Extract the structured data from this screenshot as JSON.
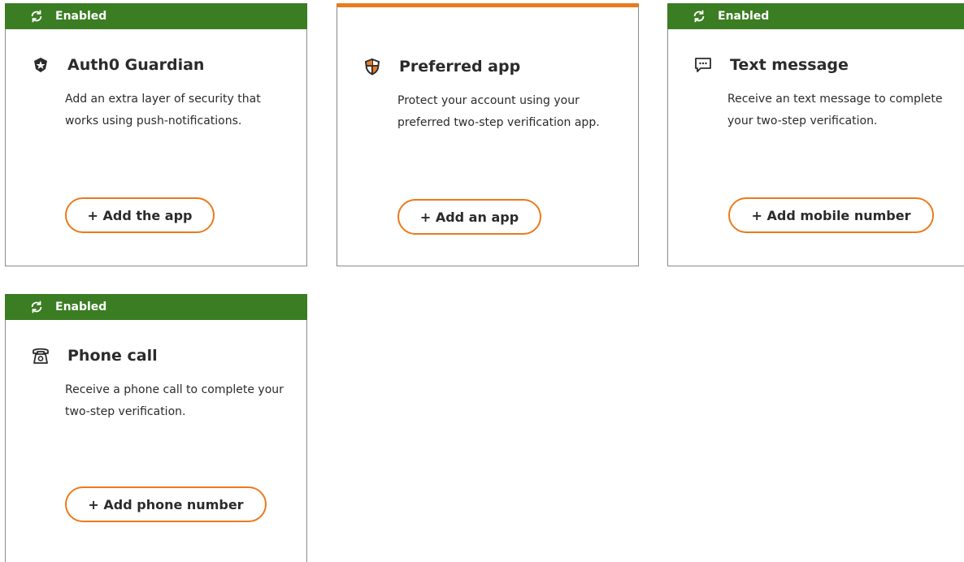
{
  "status": {
    "enabled_label": "Enabled",
    "bar_color": "#3a7d22",
    "accent_color": "#ec7a1c"
  },
  "methods": [
    {
      "icon": "shield-badge-icon",
      "title": "Auth0 Guardian",
      "description": "Add an extra layer of security that works using push-notifications.",
      "button_label": "+ Add the app",
      "enabled": true
    },
    {
      "icon": "shield-cross-icon",
      "title": "Preferred app",
      "description": "Protect your account using your preferred two-step verification app.",
      "button_label": "+ Add an app",
      "enabled": false
    },
    {
      "icon": "chat-bubble-icon",
      "title": "Text message",
      "description": "Receive an text message to complete your two-step verification.",
      "button_label": "+ Add mobile number",
      "enabled": true
    },
    {
      "icon": "telephone-icon",
      "title": "Phone call",
      "description": "Receive a phone call to complete your two-step verification.",
      "button_label": "+ Add phone number",
      "enabled": true
    }
  ]
}
